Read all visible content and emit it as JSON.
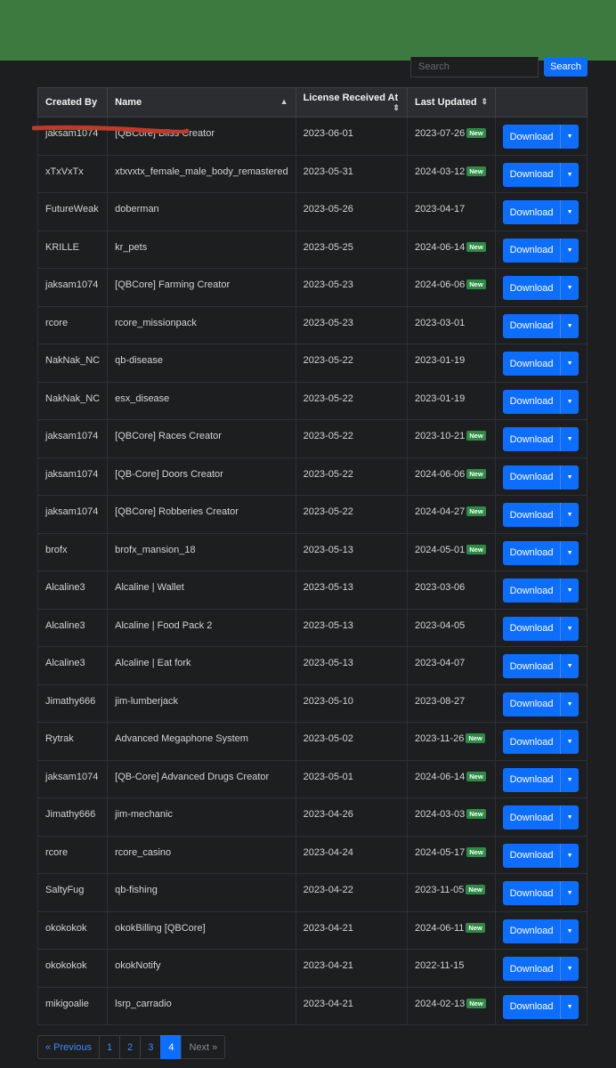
{
  "search": {
    "placeholder": "Search",
    "button": "Search"
  },
  "table": {
    "headers": [
      "Created By",
      "Name",
      "License Received At",
      "Last Updated",
      ""
    ],
    "download_label": "Download",
    "new_label": "New",
    "rows": [
      {
        "by": "jaksam1074",
        "name": "[QBCore] Bliss Creator",
        "received": "2023-06-01",
        "updated": "2023-07-26",
        "new": true
      },
      {
        "by": "xTxVxTx",
        "name": "xtxvxtx_female_male_body_remastered",
        "received": "2023-05-31",
        "updated": "2024-03-12",
        "new": true
      },
      {
        "by": "FutureWeak",
        "name": "doberman",
        "received": "2023-05-26",
        "updated": "2023-04-17",
        "new": false
      },
      {
        "by": "KRILLE",
        "name": "kr_pets",
        "received": "2023-05-25",
        "updated": "2024-06-14",
        "new": true
      },
      {
        "by": "jaksam1074",
        "name": "[QBCore] Farming Creator",
        "received": "2023-05-23",
        "updated": "2024-06-06",
        "new": true
      },
      {
        "by": "rcore",
        "name": "rcore_missionpack",
        "received": "2023-05-23",
        "updated": "2023-03-01",
        "new": false
      },
      {
        "by": "NakNak_NC",
        "name": "qb-disease",
        "received": "2023-05-22",
        "updated": "2023-01-19",
        "new": false
      },
      {
        "by": "NakNak_NC",
        "name": "esx_disease",
        "received": "2023-05-22",
        "updated": "2023-01-19",
        "new": false
      },
      {
        "by": "jaksam1074",
        "name": "[QBCore] Races Creator",
        "received": "2023-05-22",
        "updated": "2023-10-21",
        "new": true
      },
      {
        "by": "jaksam1074",
        "name": "[QB-Core] Doors Creator",
        "received": "2023-05-22",
        "updated": "2024-06-06",
        "new": true
      },
      {
        "by": "jaksam1074",
        "name": "[QBCore] Robberies Creator",
        "received": "2023-05-22",
        "updated": "2024-04-27",
        "new": true
      },
      {
        "by": "brofx",
        "name": "brofx_mansion_18",
        "received": "2023-05-13",
        "updated": "2024-05-01",
        "new": true
      },
      {
        "by": "Alcaline3",
        "name": "Alcaline | Wallet",
        "received": "2023-05-13",
        "updated": "2023-03-06",
        "new": false
      },
      {
        "by": "Alcaline3",
        "name": "Alcaline | Food Pack 2",
        "received": "2023-05-13",
        "updated": "2023-04-05",
        "new": false
      },
      {
        "by": "Alcaline3",
        "name": "Alcaline | Eat fork",
        "received": "2023-05-13",
        "updated": "2023-04-07",
        "new": false
      },
      {
        "by": "Jimathy666",
        "name": "jim-lumberjack",
        "received": "2023-05-10",
        "updated": "2023-08-27",
        "new": false
      },
      {
        "by": "Rytrak",
        "name": "Advanced Megaphone System",
        "received": "2023-05-02",
        "updated": "2023-11-26",
        "new": true
      },
      {
        "by": "jaksam1074",
        "name": "[QB-Core] Advanced Drugs Creator",
        "received": "2023-05-01",
        "updated": "2024-06-14",
        "new": true
      },
      {
        "by": "Jimathy666",
        "name": "jim-mechanic",
        "received": "2023-04-26",
        "updated": "2024-03-03",
        "new": true
      },
      {
        "by": "rcore",
        "name": "rcore_casino",
        "received": "2023-04-24",
        "updated": "2024-05-17",
        "new": true
      },
      {
        "by": "SaltyFug",
        "name": "qb-fishing",
        "received": "2023-04-22",
        "updated": "2023-11-05",
        "new": true
      },
      {
        "by": "okokokok",
        "name": "okokBilling [QBCore]",
        "received": "2023-04-21",
        "updated": "2024-06-11",
        "new": true
      },
      {
        "by": "okokokok",
        "name": "okokNotify",
        "received": "2023-04-21",
        "updated": "2022-11-15",
        "new": false
      },
      {
        "by": "mikigoalie",
        "name": "lsrp_carradio",
        "received": "2023-04-21",
        "updated": "2024-02-13",
        "new": true
      }
    ]
  },
  "pagination": {
    "previous": "« Previous",
    "pages": [
      "1",
      "2",
      "3",
      "4"
    ],
    "active": "4",
    "next": "Next »"
  },
  "colors": {
    "header_bar": "#3c7a40",
    "primary": "#0d6efd",
    "badge": "#2e8b46",
    "redaction": "#c0392b"
  }
}
